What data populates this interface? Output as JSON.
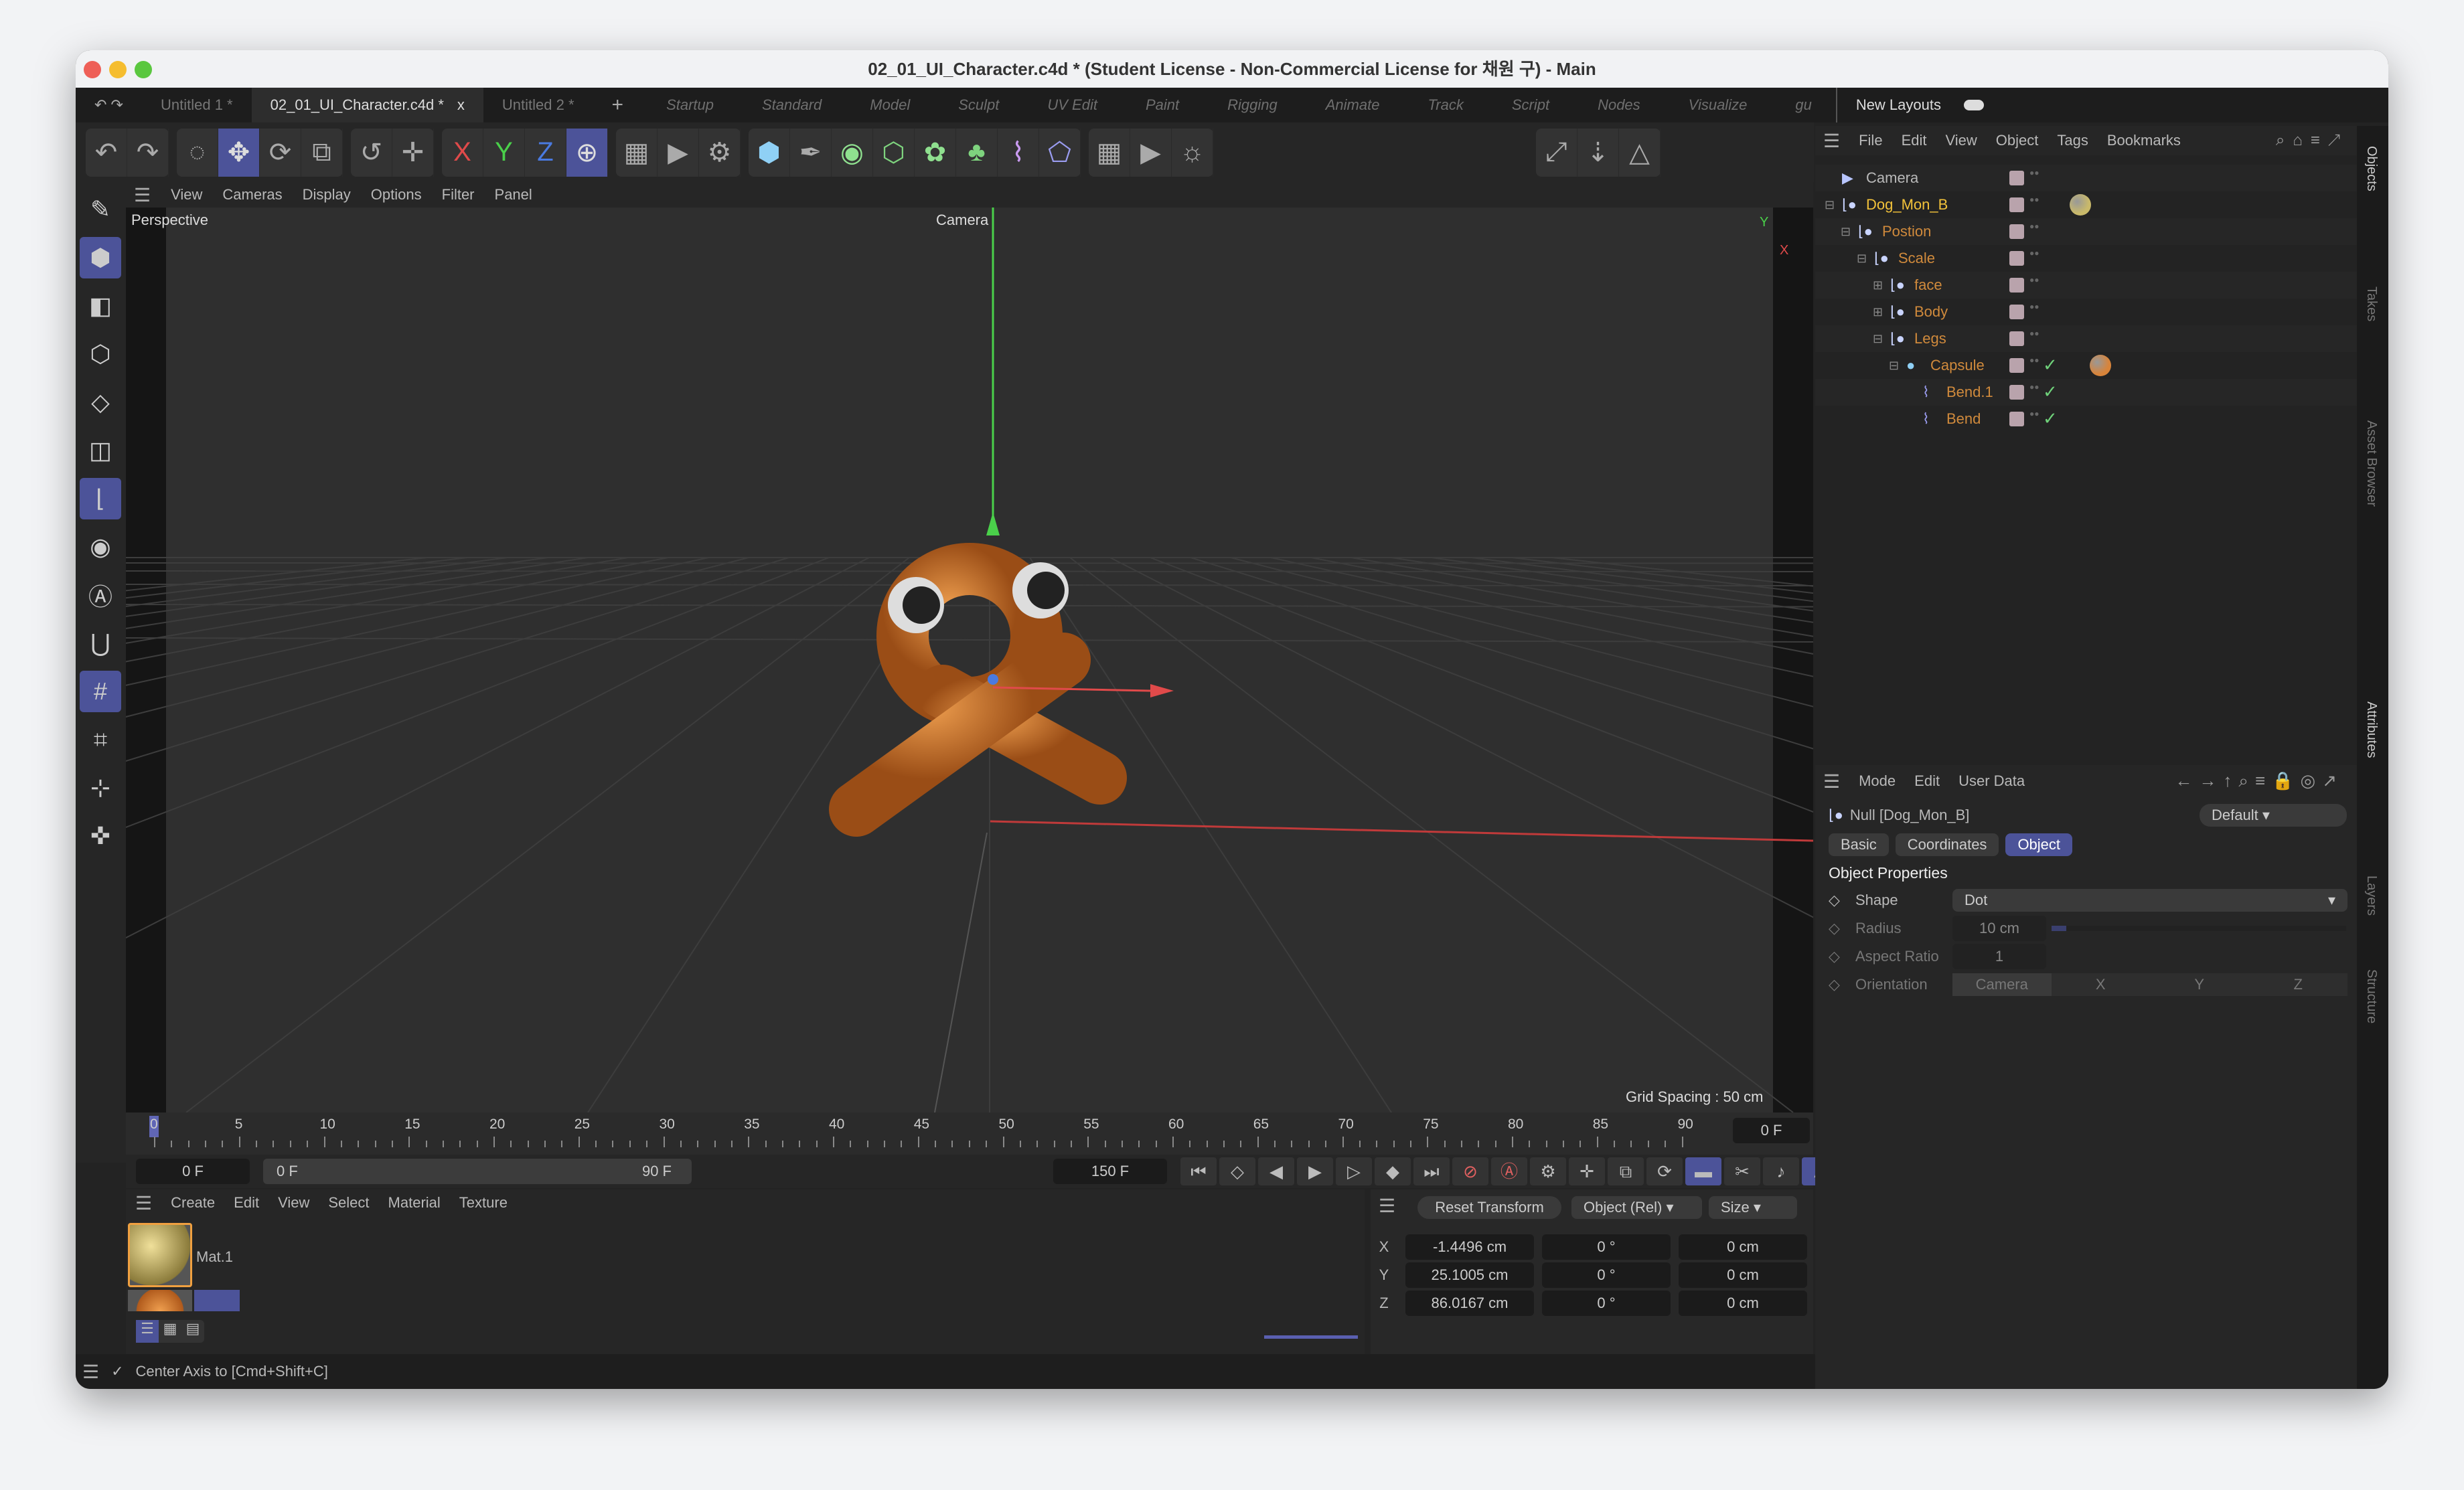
{
  "window": {
    "title": "02_01_UI_Character.c4d * (Student License - Non-Commercial License for 채원 구) - Main"
  },
  "tabs": [
    {
      "label": "Untitled 1 *"
    },
    {
      "label": "02_01_UI_Character.c4d *",
      "active": true,
      "close": "x"
    },
    {
      "label": "Untitled 2 *"
    }
  ],
  "layouts": [
    "Startup",
    "Standard",
    "Model",
    "Sculpt",
    "UV Edit",
    "Paint",
    "Rigging",
    "Animate",
    "Track",
    "Script",
    "Nodes",
    "Visualize",
    "gu"
  ],
  "new_layouts": "New Layouts",
  "toolbar": {
    "groups": [
      [
        "undo",
        "redo"
      ],
      [
        "live-selection",
        "move",
        "rotate",
        "scale"
      ],
      [
        "recent-tools",
        "transform"
      ],
      [
        "x-axis",
        "y-axis",
        "z-axis",
        "world-coordinates"
      ],
      [
        "render-view",
        "render-to-picture-viewer",
        "render-settings"
      ],
      [
        "cube",
        "pen",
        "subdivision",
        "extrude",
        "cloner",
        "spline-mask",
        "bend-deformer",
        "deformer"
      ],
      [
        "floor",
        "camera",
        "light"
      ],
      [
        "viewport-solo",
        "drop-to-floor",
        "symmetry"
      ]
    ],
    "selected": [
      "move",
      "world-coordinates"
    ]
  },
  "left_tools": [
    "edit-mode",
    "model-mode",
    "polygon-mode",
    "edge-mode",
    "point-mode",
    "uv-mode",
    "axis-mode",
    "enable-workplane",
    "snap",
    "magnet",
    "grid-snap",
    "workplane-lock",
    "dynamic-guide",
    "locked-workplane"
  ],
  "viewport": {
    "menu": [
      "View",
      "Cameras",
      "Display",
      "Options",
      "Filter",
      "Panel"
    ],
    "label": "Perspective",
    "camera": "Camera",
    "grid_spacing": "Grid Spacing : 50 cm",
    "axis_colors": {
      "x": "#e04a4a",
      "y": "#4ad04a",
      "z": "#4a7ae0"
    }
  },
  "timeline": {
    "ticks": [
      "0",
      "5",
      "10",
      "15",
      "20",
      "25",
      "30",
      "35",
      "40",
      "45",
      "50",
      "55",
      "60",
      "65",
      "70",
      "75",
      "80",
      "85",
      "90"
    ],
    "current": "0 F",
    "start": "0 F",
    "range_start": "0 F",
    "range_end": "90 F",
    "end": "150 F"
  },
  "materials": {
    "menu": [
      "Create",
      "Edit",
      "View",
      "Select",
      "Material",
      "Texture"
    ],
    "items": [
      {
        "name": "Mat.1",
        "color": "#c9b96a"
      },
      {
        "name": "",
        "color": "#d8843a"
      }
    ]
  },
  "coords": {
    "reset": "Reset Transform",
    "mode": "Object (Rel)",
    "size_mode": "Size",
    "rows": [
      {
        "axis": "X",
        "pos": "-1.4496 cm",
        "rot": "0 °",
        "size": "0 cm"
      },
      {
        "axis": "Y",
        "pos": "25.1005 cm",
        "rot": "0 °",
        "size": "0 cm"
      },
      {
        "axis": "Z",
        "pos": "86.0167 cm",
        "rot": "0 °",
        "size": "0 cm"
      }
    ]
  },
  "status": {
    "text": "Center Axis to [Cmd+Shift+C]"
  },
  "objects": {
    "menu": [
      "File",
      "Edit",
      "View",
      "Object",
      "Tags",
      "Bookmarks"
    ],
    "tree": [
      {
        "name": "Camera",
        "level": 0,
        "icon": "camera",
        "color": "#b9b9b9"
      },
      {
        "name": "Dog_Mon_B",
        "level": 0,
        "icon": "null",
        "expand": "-",
        "color": "#f2c23a",
        "tag": "#c9b96a"
      },
      {
        "name": "Postion",
        "level": 1,
        "icon": "null",
        "expand": "-",
        "color": "#d08a3c"
      },
      {
        "name": "Scale",
        "level": 2,
        "icon": "null",
        "expand": "-",
        "color": "#d08a3c"
      },
      {
        "name": "face",
        "level": 3,
        "icon": "null",
        "expand": "+",
        "color": "#d08a3c"
      },
      {
        "name": "Body",
        "level": 3,
        "icon": "null",
        "expand": "+",
        "color": "#d08a3c"
      },
      {
        "name": "Legs",
        "level": 3,
        "icon": "null",
        "expand": "-",
        "color": "#d08a3c"
      },
      {
        "name": "Capsule",
        "level": 4,
        "icon": "capsule",
        "expand": "-",
        "color": "#d08a3c",
        "check": true,
        "tag": "#d8843a"
      },
      {
        "name": "Bend.1",
        "level": 5,
        "icon": "bend",
        "color": "#d08a3c",
        "check": true
      },
      {
        "name": "Bend",
        "level": 5,
        "icon": "bend",
        "color": "#d08a3c",
        "check": true
      }
    ]
  },
  "attributes": {
    "menu": [
      "Mode",
      "Edit",
      "User Data"
    ],
    "object": "Null [Dog_Mon_B]",
    "preset": "Default",
    "tabs": [
      "Basic",
      "Coordinates",
      "Object"
    ],
    "active_tab": "Object",
    "section": "Object Properties",
    "props": [
      {
        "label": "Shape",
        "value": "Dot"
      },
      {
        "label": "Radius",
        "value": "10 cm",
        "slider": 0.05
      },
      {
        "label": "Aspect Ratio",
        "value": "1"
      },
      {
        "label": "Orientation",
        "options": [
          "Camera",
          "X",
          "Y",
          "Z"
        ]
      }
    ]
  },
  "side_tabs": [
    "Objects",
    "Takes",
    "Asset Browser",
    "Attributes",
    "Layers",
    "Structure"
  ],
  "accent": "#4c5399"
}
